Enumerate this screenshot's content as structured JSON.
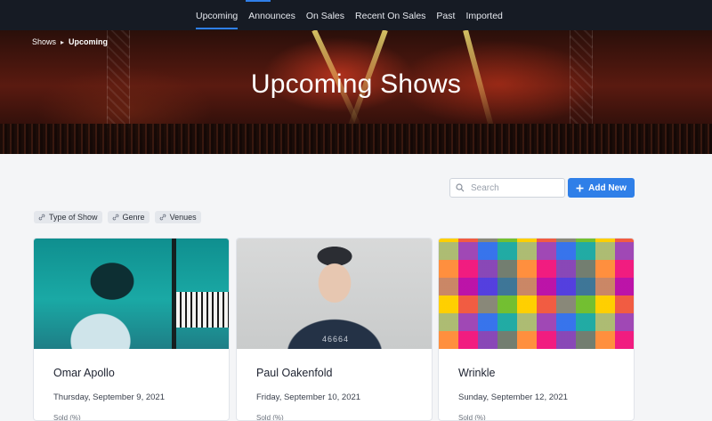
{
  "nav": {
    "tabs": [
      {
        "label": "Upcoming",
        "active": true
      },
      {
        "label": "Announces"
      },
      {
        "label": "On Sales"
      },
      {
        "label": "Recent On Sales"
      },
      {
        "label": "Past"
      },
      {
        "label": "Imported"
      }
    ]
  },
  "hero": {
    "breadcrumb": [
      "Shows",
      "Upcoming"
    ],
    "title": "Upcoming Shows"
  },
  "toolbar": {
    "search_placeholder": "Search",
    "add_label": "Add New"
  },
  "filters": [
    "Type of Show",
    "Genre",
    "Venues"
  ],
  "cards": [
    {
      "name": "Omar Apollo",
      "date": "Thursday, September 9, 2021",
      "sold": "Sold (%)"
    },
    {
      "name": "Paul Oakenfold",
      "date": "Friday, September 10, 2021",
      "sold": "Sold (%)",
      "shirt_text": "46664"
    },
    {
      "name": "Wrinkle",
      "date": "Sunday, September 12, 2021",
      "sold": "Sold (%)"
    }
  ],
  "colors": {
    "accent": "#2f7fe8",
    "nav_bg": "#161b24",
    "page_bg": "#f4f5f7"
  },
  "icons": {
    "search": "magnifier-icon",
    "add": "plus-icon",
    "filter": "link-icon"
  }
}
